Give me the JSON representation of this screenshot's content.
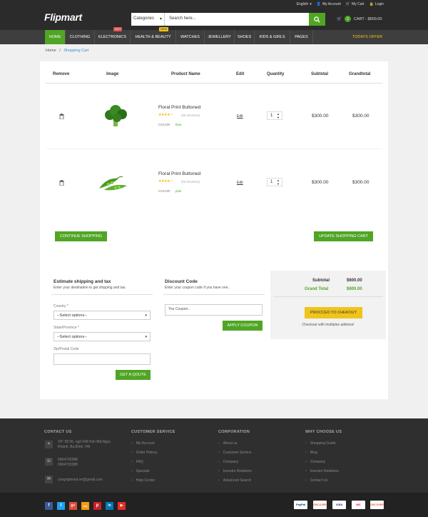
{
  "header": {
    "logo": "Flipmart",
    "language": "English",
    "account": "My Account",
    "cart_link": "My Cart",
    "login": "Login",
    "search_category": "Categories",
    "search_placeholder": "Search here...",
    "cart_count": "2",
    "cart_label": "CART - $600.00"
  },
  "nav": {
    "items": [
      "HOME",
      "CLOTHING",
      "ELECTRONICS",
      "HEALTH & BEAUTY",
      "WATCHES",
      "JEWELLERY",
      "SHOES",
      "KIDS & GIRLS",
      "PAGES"
    ],
    "today": "TODAYS OFFER",
    "tag_hot": "HOT",
    "tag_new": "NEW"
  },
  "breadcrumb": {
    "home": "Home",
    "sep": "/",
    "current": "Shopping Cart"
  },
  "cart": {
    "columns": [
      "Remove",
      "Image",
      "Product Name",
      "Edit",
      "Quantity",
      "Subtotal",
      "Grandtotal"
    ],
    "rows": [
      {
        "name": "Floral Print Buttoned",
        "rating": "★★★★☆",
        "reviews": "(06 Reviews)",
        "color_label": "COLOR:",
        "color": "blue",
        "edit": "Edit",
        "qty": "1",
        "subtotal": "$300.00",
        "grandtotal": "$300.00"
      },
      {
        "name": "Floral Print Buttoned",
        "rating": "★★★★☆",
        "reviews": "(06 Reviews)",
        "color_label": "COLOR:",
        "color": "pink",
        "edit": "Edit",
        "qty": "1",
        "subtotal": "$300.00",
        "grandtotal": "$300.00"
      }
    ],
    "continue": "CONTINUE SHOPPING",
    "update": "UPDATE SHOPPING CART"
  },
  "shipping": {
    "title": "Estimate shipping and tax",
    "subtitle": "Enter your destination to get shipping and tax.",
    "country_label": "Country",
    "state_label": "State/Province",
    "zip_label": "Zip/Postal Code",
    "required": "*",
    "country_value": "--Select options--",
    "state_value": "--Select options--",
    "button": "GET A QOUTE"
  },
  "discount": {
    "title": "Discount Code",
    "subtitle": "Enter your coupon code if you have one..",
    "placeholder": "You Coupon..",
    "button": "APPLY COUPON"
  },
  "totals": {
    "subtotal_label": "Subtotal",
    "subtotal": "$600.00",
    "grand_label": "Grand Total",
    "grand": "$600.00",
    "checkout": "PROCCED TO CHEKOUT",
    "multi": "Checkout with multiples address!"
  },
  "footer": {
    "contact_title": "CONTACT US",
    "address": "VP: 58 55, ngõ 648 Kim Mã,Ngọc Khánh, Ba Đình, HN",
    "phone1": "0904720388",
    "phone2": "0904720388",
    "email": "congnghesst.vn@gmail.com",
    "service_title": "CUSTOMER SERVICE",
    "service": [
      "My Account",
      "Order History",
      "FAQ",
      "Specials",
      "Help Center"
    ],
    "corp_title": "CORPORATION",
    "corp": [
      "About us",
      "Customer Service",
      "Company",
      "Investor Relations",
      "Advanced Search"
    ],
    "why_title": "WHY CHOOSE US",
    "why": [
      "Shopping Guide",
      "Blog",
      "Company",
      "Investor Relations",
      "Contact Us"
    ],
    "social": [
      "f",
      "t",
      "g+",
      "rss",
      "p",
      "in",
      "▶"
    ],
    "payments": [
      "PayPal",
      "DISCOVER",
      "VISA",
      "MC",
      "DISCOVER"
    ]
  },
  "colors": {
    "accent": "#50a524",
    "yellow": "#f0c41b",
    "dark": "#2b2b2b"
  }
}
